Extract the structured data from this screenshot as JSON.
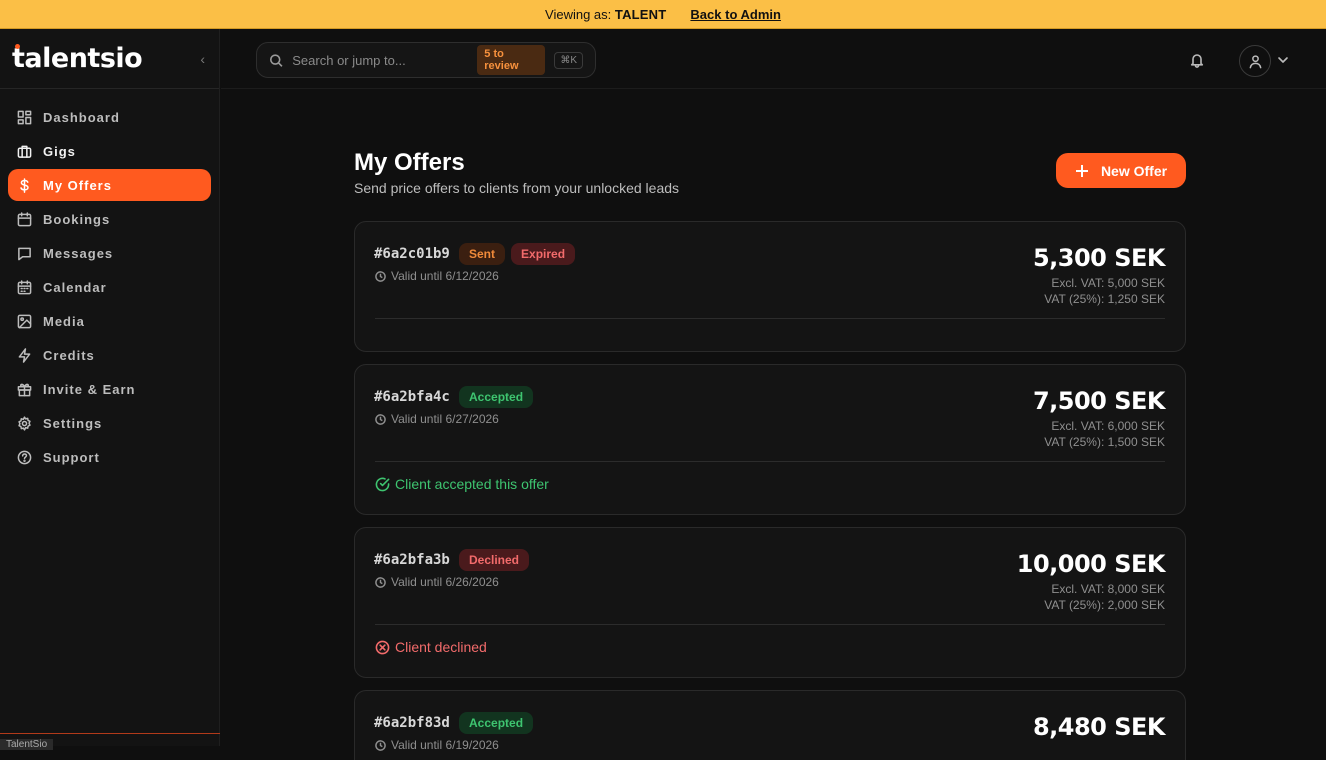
{
  "banner": {
    "viewing_label": "Viewing as:",
    "role": "TALENT",
    "back_label": "Back to Admin"
  },
  "sidebar": {
    "logo": "talentsio",
    "items": [
      {
        "label": "Dashboard",
        "icon": "grid-icon"
      },
      {
        "label": "Gigs",
        "icon": "briefcase-icon"
      },
      {
        "label": "My Offers",
        "icon": "dollar-icon",
        "active": true
      },
      {
        "label": "Bookings",
        "icon": "calendar-icon"
      },
      {
        "label": "Messages",
        "icon": "chat-icon"
      },
      {
        "label": "Calendar",
        "icon": "calendar-grid-icon"
      },
      {
        "label": "Media",
        "icon": "image-icon"
      },
      {
        "label": "Credits",
        "icon": "bolt-icon"
      },
      {
        "label": "Invite & Earn",
        "icon": "gift-icon"
      },
      {
        "label": "Settings",
        "icon": "gear-icon"
      },
      {
        "label": "Support",
        "icon": "help-icon"
      }
    ],
    "footer_text": "TalentSio"
  },
  "search": {
    "placeholder": "Search or jump to...",
    "review_badge": "5 to review",
    "shortcut": "⌘K"
  },
  "page": {
    "title": "My Offers",
    "subtitle": "Send price offers to clients from your unlocked leads",
    "new_button": "New Offer"
  },
  "offers": [
    {
      "id": "#6a2c01b9",
      "badges": [
        "Sent",
        "Expired"
      ],
      "valid": "Valid until 6/12/2026",
      "amount": "5,300 SEK",
      "excl": "Excl. VAT: 5,000 SEK",
      "vat": "VAT (25%): 1,250 SEK",
      "status": ""
    },
    {
      "id": "#6a2bfa4c",
      "badges": [
        "Accepted"
      ],
      "valid": "Valid until 6/27/2026",
      "amount": "7,500 SEK",
      "excl": "Excl. VAT: 6,000 SEK",
      "vat": "VAT (25%): 1,500 SEK",
      "status": "Client accepted this offer"
    },
    {
      "id": "#6a2bfa3b",
      "badges": [
        "Declined"
      ],
      "valid": "Valid until 6/26/2026",
      "amount": "10,000 SEK",
      "excl": "Excl. VAT: 8,000 SEK",
      "vat": "VAT (25%): 2,000 SEK",
      "status": "Client declined"
    },
    {
      "id": "#6a2bf83d",
      "badges": [
        "Accepted"
      ],
      "valid": "Valid until 6/19/2026",
      "amount": "8,480 SEK"
    }
  ],
  "colors": {
    "accent": "#ff5a1f",
    "banner": "#fbbf46",
    "accepted": "#3ec470",
    "declined": "#f26b6b"
  }
}
